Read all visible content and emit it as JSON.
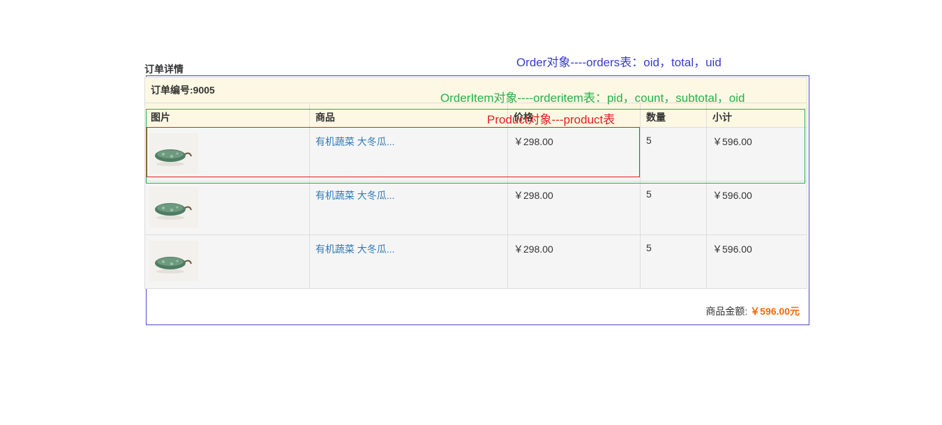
{
  "page": {
    "title": "订单详情"
  },
  "order": {
    "number_label": "订单编号:9005",
    "columns": [
      "图片",
      "商品",
      "价格",
      "数量",
      "小计"
    ],
    "items": [
      {
        "product": "有机蔬菜    大冬瓜...",
        "price": "￥298.00",
        "quantity": "5",
        "subtotal": "￥596.00"
      },
      {
        "product": "有机蔬菜    大冬瓜...",
        "price": "￥298.00",
        "quantity": "5",
        "subtotal": "￥596.00"
      },
      {
        "product": "有机蔬菜    大冬瓜...",
        "price": "￥298.00",
        "quantity": "5",
        "subtotal": "￥596.00"
      }
    ],
    "total_label": "商品金额:",
    "total_value": "￥596.00元"
  },
  "annotations": {
    "order": "Order对象----orders表：oid，total，uid",
    "orderitem": "OrderItem对象----orderitem表：pid，count，subtotal，oid",
    "product": "Product对象---product表"
  },
  "colors": {
    "order_annotation": "#3a3ad0",
    "orderitem_annotation": "#27b04a",
    "product_annotation": "#e02020",
    "header_bg": "#fcf8e3",
    "row_bg": "#f5f5f5",
    "link": "#337ab7",
    "total_accent": "#ff6600"
  }
}
